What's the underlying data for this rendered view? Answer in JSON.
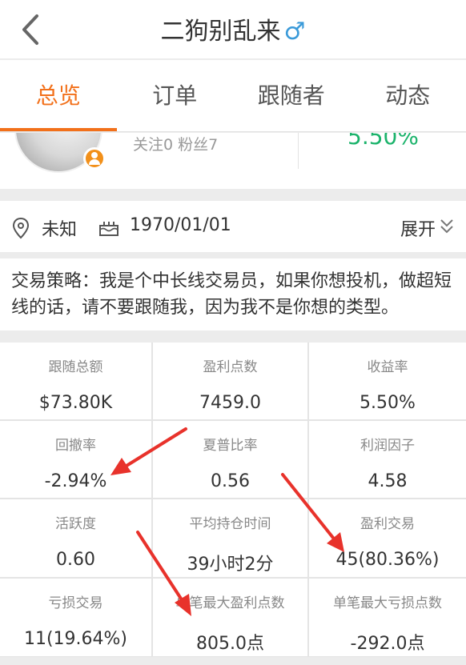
{
  "header": {
    "title": "二狗别乱来",
    "gender_symbol": "♂"
  },
  "tabs": [
    {
      "label": "总览",
      "active": true
    },
    {
      "label": "订单",
      "active": false
    },
    {
      "label": "跟随者",
      "active": false
    },
    {
      "label": "动态",
      "active": false
    }
  ],
  "profile": {
    "follow_text": "关注0  粉丝7",
    "return_rate": "5.50%"
  },
  "info": {
    "location": "未知",
    "birthday": "1970/01/01",
    "expand_label": "展开"
  },
  "strategy": "交易策略：我是个中长线交易员，如果你想投机，做超短线的话，请不要跟随我，因为我不是你想的类型。",
  "stats": [
    {
      "label": "跟随总额",
      "value": "$73.80K"
    },
    {
      "label": "盈利点数",
      "value": "7459.0"
    },
    {
      "label": "收益率",
      "value": "5.50%"
    },
    {
      "label": "回撤率",
      "value": "-2.94%"
    },
    {
      "label": "夏普比率",
      "value": "0.56"
    },
    {
      "label": "利润因子",
      "value": "4.58"
    },
    {
      "label": "活跃度",
      "value": "0.60"
    },
    {
      "label": "平均持仓时间",
      "value": "39小时2分"
    },
    {
      "label": "盈利交易",
      "value": "45(80.36%)"
    },
    {
      "label": "亏损交易",
      "value": "11(19.64%)"
    },
    {
      "label": "单笔最大盈利点数",
      "value": "805.0点"
    },
    {
      "label": "单笔最大亏损点数",
      "value": "-292.0点"
    }
  ],
  "colors": {
    "accent": "#f2701a",
    "positive": "#1bb36b",
    "annotation_arrow": "#e8322b"
  }
}
